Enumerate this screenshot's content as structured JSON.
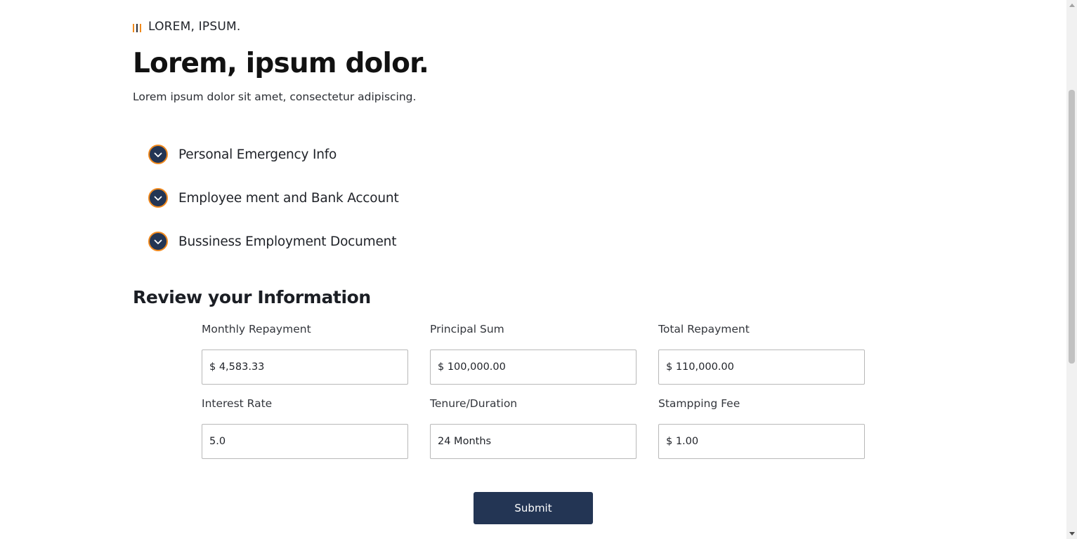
{
  "brand": {
    "name": "LOREM, IPSUM.",
    "icon": "logo-bars-icon",
    "accent_color": "#f08a1c"
  },
  "header": {
    "title": "Lorem, ipsum dolor.",
    "subtitle": "Lorem ipsum dolor sit amet, consectetur adipiscing."
  },
  "steps": [
    {
      "label": "Personal Emergency Info",
      "icon": "check-circle-icon",
      "status": "completed"
    },
    {
      "label": "Employee ment and Bank Account",
      "icon": "check-circle-icon",
      "status": "completed"
    },
    {
      "label": "Bussiness Employment Document",
      "icon": "check-circle-icon",
      "status": "completed"
    }
  ],
  "review": {
    "title": "Review your Information",
    "fields": [
      {
        "label": "Monthly Repayment",
        "value": "$ 4,583.33"
      },
      {
        "label": "Principal Sum",
        "value": "$ 100,000.00"
      },
      {
        "label": "Total Repayment",
        "value": "$ 110,000.00"
      },
      {
        "label": "Interest Rate",
        "value": "5.0"
      },
      {
        "label": "Tenure/Duration",
        "value": "24 Months"
      },
      {
        "label": "Stampping Fee",
        "value": "$ 1.00"
      }
    ]
  },
  "actions": {
    "submit_label": "Submit",
    "primary_color": "#233554"
  }
}
